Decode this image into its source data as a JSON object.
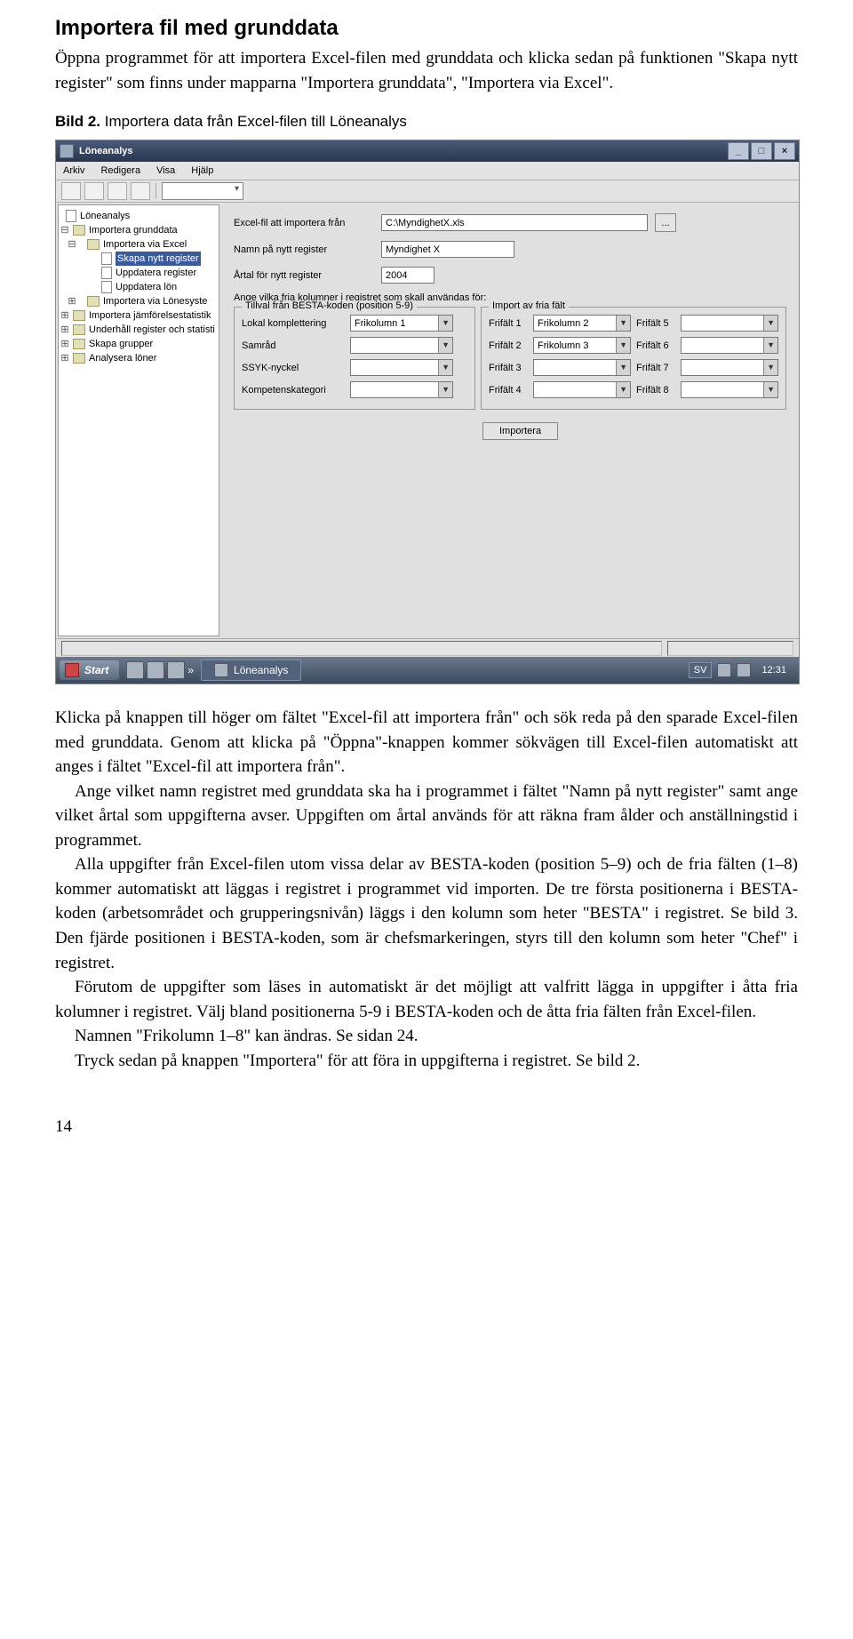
{
  "doc": {
    "title": "Importera fil med grunddata",
    "intro": "Öppna programmet för att importera Excel-filen med grunddata och klicka sedan på funktionen \"Skapa nytt register\" som finns under mapparna \"Importera grunddata\", \"Importera via Excel\".",
    "caption_bold": "Bild 2.",
    "caption_rest": " Importera data från Excel-filen till Löneanalys",
    "p1": "Klicka på knappen till höger om fältet \"Excel-fil att importera från\" och sök reda på den sparade Excel-filen med grunddata. Genom att klicka på \"Öppna\"-knappen kommer sökvägen till Excel-filen automatiskt att anges i fältet \"Excel-fil att importera från\".",
    "p2": "Ange vilket namn registret med grunddata ska ha i programmet i fältet \"Namn på nytt register\" samt ange vilket årtal som uppgifterna avser. Uppgiften om årtal används för att räkna fram ålder och anställningstid i programmet.",
    "p3": "Alla uppgifter från Excel-filen utom vissa delar av BESTA-koden (position 5–9) och de fria fälten (1–8) kommer automatiskt att läggas i registret i programmet vid importen. De tre första positionerna i BESTA-koden (arbetsområdet och grupperingsnivån) läggs i den kolumn som heter \"BESTA\" i registret. Se bild 3. Den fjärde positionen i BESTA-koden, som är chefsmarkeringen, styrs till den kolumn som heter \"Chef\" i registret.",
    "p4": "Förutom de uppgifter som läses in automatiskt är det möjligt att valfritt lägga in uppgifter i åtta fria kolumner i registret. Välj bland positionerna 5-9 i BESTA-koden och de åtta fria fälten från Excel-filen.",
    "p5": "Namnen \"Frikolumn 1–8\" kan ändras. Se sidan 24.",
    "p6": "Tryck sedan på knappen \"Importera\" för att föra in uppgifterna i registret. Se bild 2.",
    "pagenum": "14"
  },
  "app": {
    "title": "Löneanalys",
    "menus": [
      "Arkiv",
      "Redigera",
      "Visa",
      "Hjälp"
    ],
    "tree": {
      "root": "Löneanalys",
      "n1": "Importera grunddata",
      "n1a": "Importera via Excel",
      "n1a1": "Skapa nytt register",
      "n1a2": "Uppdatera register",
      "n1a3": "Uppdatera lön",
      "n1b": "Importera via Lönesyste",
      "n2": "Importera jämförelsestatistik",
      "n3": "Underhåll register och statisti",
      "n4": "Skapa grupper",
      "n5": "Analysera löner"
    },
    "form": {
      "l_file": "Excel-fil att importera från",
      "v_file": "C:\\MyndighetX.xls",
      "browse": "...",
      "l_name": "Namn på nytt register",
      "v_name": "Myndighet X",
      "l_year": "Årtal för nytt register",
      "v_year": "2004",
      "groupcaption": "Ange vilka fria kolumner i registret som skall användas för:",
      "g1_legend": "Tillval från BESTA-koden (position 5-9)",
      "g1_r1": "Lokal komplettering",
      "g1_r2": "Samråd",
      "g1_r3": "SSYK-nyckel",
      "g1_r4": "Kompetenskategori",
      "g1_v1": "Frikolumn 1",
      "g2_legend": "Import av fria fält",
      "g2_l1": "Frifält 1",
      "g2_v1": "Frikolumn 2",
      "g2_l5": "Frifält 5",
      "g2_l2": "Frifält 2",
      "g2_v2": "Frikolumn 3",
      "g2_l6": "Frifält 6",
      "g2_l3": "Frifält 3",
      "g2_l7": "Frifält 7",
      "g2_l4": "Frifält 4",
      "g2_l8": "Frifält 8",
      "btn_import": "Importera"
    },
    "taskbar": {
      "start": "Start",
      "task1": "Löneanalys",
      "lang": "SV",
      "clock": "12:31",
      "chevrons": "»"
    }
  }
}
